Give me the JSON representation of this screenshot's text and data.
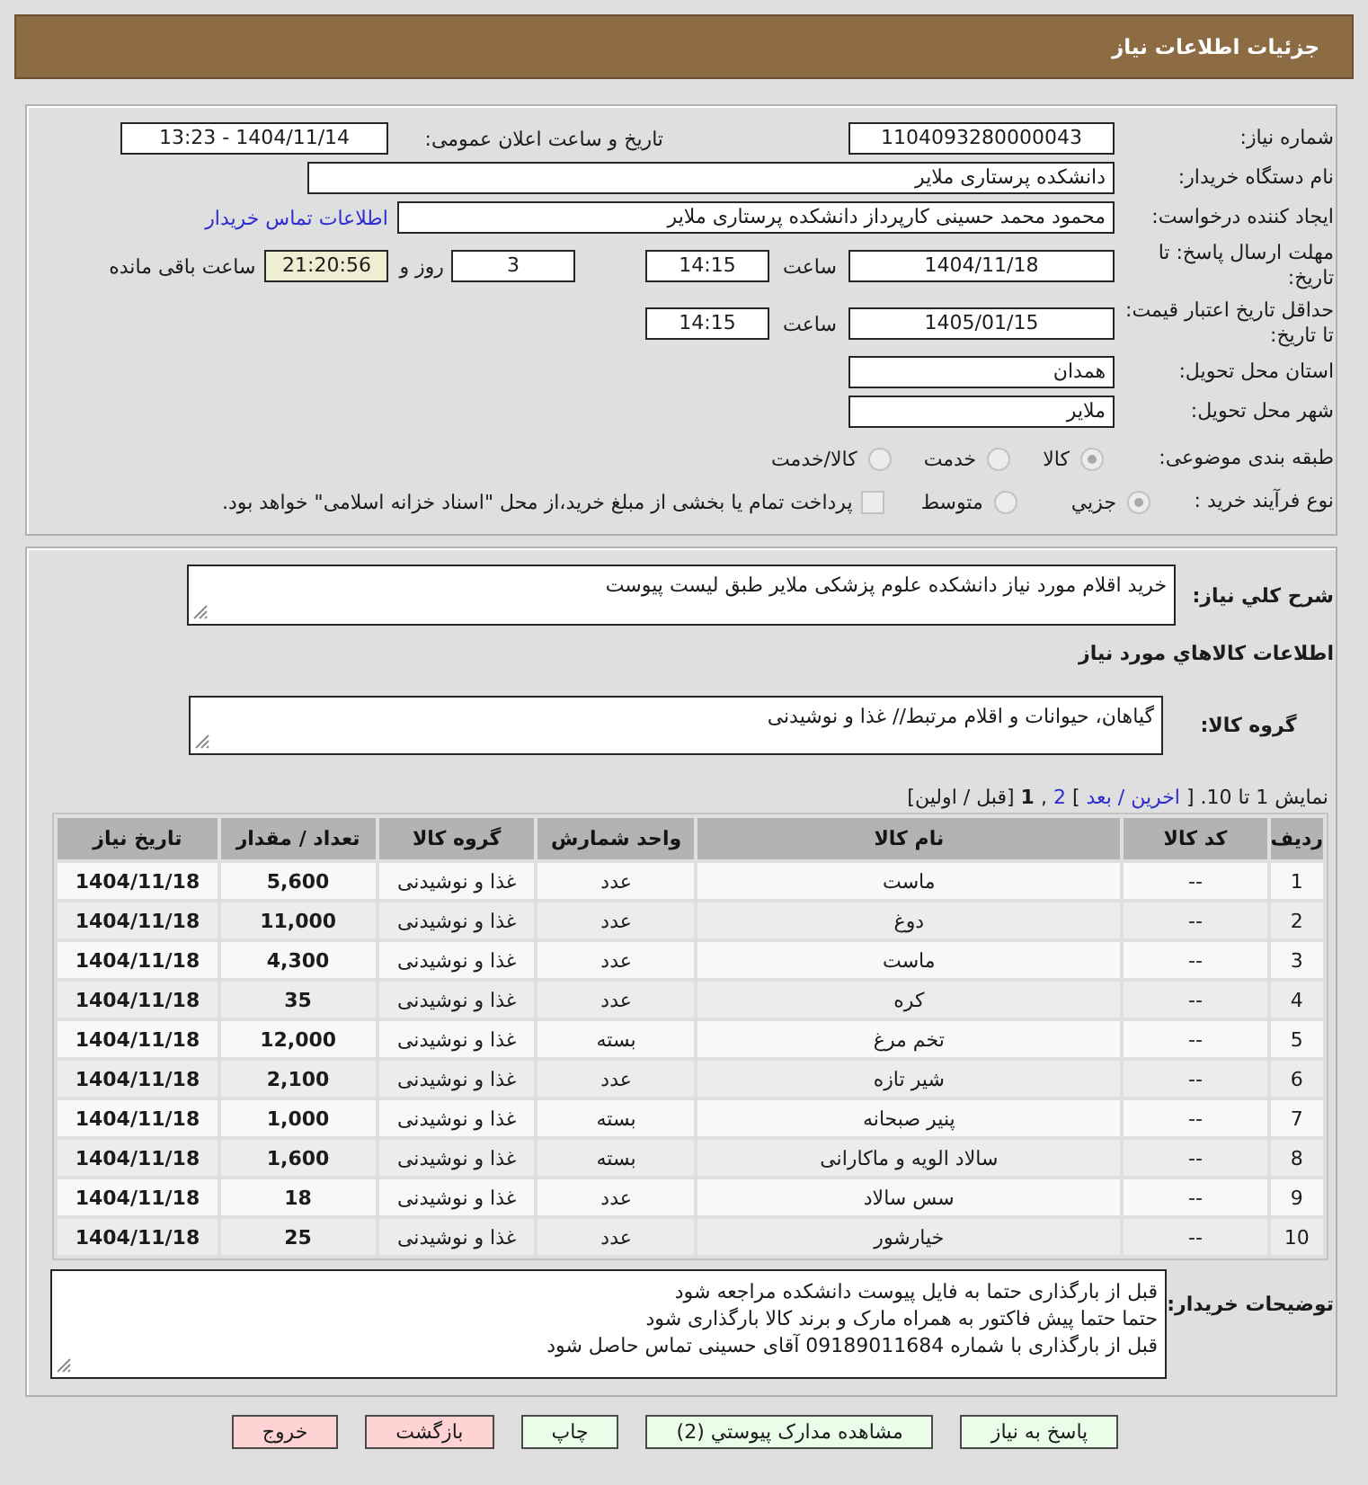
{
  "header": {
    "title": "جزئیات اطلاعات نیاز"
  },
  "details": {
    "need_number": {
      "label": "شماره نیاز:",
      "value": "1104093280000043"
    },
    "announcement": {
      "label": "تاریخ و ساعت اعلان عمومی:",
      "value": "1404/11/14 - 13:23"
    },
    "buyer_org": {
      "label": "نام دستگاه خریدار:",
      "value": "دانشکده پرستاری ملایر"
    },
    "requester": {
      "label": "ایجاد کننده درخواست:",
      "value": "محمود محمد حسینی کارپرداز دانشکده پرستاری ملایر",
      "contact_link": "اطلاعات تماس خریدار"
    },
    "reply_deadline": {
      "label": "مهلت ارسال پاسخ: تا تاریخ:",
      "date": "1404/11/18",
      "time_label": "ساعت",
      "time": "14:15",
      "days": "3",
      "days_label": "روز و",
      "remaining": "21:20:56",
      "remaining_label": "ساعت باقی مانده"
    },
    "price_validity": {
      "label": "حداقل تاریخ اعتبار قیمت: تا تاریخ:",
      "date": "1405/01/15",
      "time_label": "ساعت",
      "time": "14:15"
    },
    "province": {
      "label": "استان محل تحویل:",
      "value": "همدان"
    },
    "city": {
      "label": "شهر محل تحویل:",
      "value": "ملایر"
    },
    "category": {
      "label": "طبقه بندی موضوعی:",
      "disabled": true,
      "options": [
        {
          "label": "کالا",
          "selected": true
        },
        {
          "label": "خدمت",
          "selected": false
        },
        {
          "label": "کالا/خدمت",
          "selected": false
        }
      ]
    },
    "purchase_type": {
      "label": "نوع فرآیند خرید :",
      "disabled": true,
      "options": [
        {
          "label": "جزيي",
          "selected": true
        },
        {
          "label": "متوسط",
          "selected": false
        }
      ],
      "treasury_payment": {
        "label": "پرداخت تمام یا بخشی از مبلغ خرید،از محل \"اسناد خزانه اسلامی\" خواهد بود.",
        "checked": false
      }
    }
  },
  "description": {
    "label": "شرح کلي نياز:",
    "value": "خرید اقلام مورد نیاز دانشکده علوم پزشکی ملایر طبق لیست پیوست"
  },
  "goods": {
    "title": "اطلاعات کالاهاي مورد نياز",
    "group_label": "گروه کالا:",
    "group_value": "گیاهان، حیوانات و اقلام مرتبط// غذا و نوشیدنی",
    "pagination": [
      {
        "text": "نمایش 1 تا 10. [",
        "kind": "text"
      },
      {
        "text": "اخرین / بعد",
        "kind": "link"
      },
      {
        "text": "]",
        "kind": "text"
      },
      {
        "text": "2",
        "kind": "link"
      },
      {
        "text": ",",
        "kind": "text"
      },
      {
        "text": "1",
        "kind": "current"
      },
      {
        "text": "[قبل / اولین]",
        "kind": "text"
      }
    ],
    "table": {
      "columns": [
        "ردیف",
        "کد کالا",
        "نام کالا",
        "واحد شمارش",
        "گروه کالا",
        "تعداد / مقدار",
        "تاریخ نیاز"
      ],
      "rows": [
        [
          "1",
          "--",
          "ماست",
          "عدد",
          "غذا و نوشیدنی",
          "5,600",
          "1404/11/18"
        ],
        [
          "2",
          "--",
          "دوغ",
          "عدد",
          "غذا و نوشیدنی",
          "11,000",
          "1404/11/18"
        ],
        [
          "3",
          "--",
          "ماست",
          "عدد",
          "غذا و نوشیدنی",
          "4,300",
          "1404/11/18"
        ],
        [
          "4",
          "--",
          "کره",
          "عدد",
          "غذا و نوشیدنی",
          "35",
          "1404/11/18"
        ],
        [
          "5",
          "--",
          "تخم مرغ",
          "بسته",
          "غذا و نوشیدنی",
          "12,000",
          "1404/11/18"
        ],
        [
          "6",
          "--",
          "شیر تازه",
          "عدد",
          "غذا و نوشیدنی",
          "2,100",
          "1404/11/18"
        ],
        [
          "7",
          "--",
          "پنیر صبحانه",
          "بسته",
          "غذا و نوشیدنی",
          "1,000",
          "1404/11/18"
        ],
        [
          "8",
          "--",
          "سالاد الویه و ماکارانی",
          "بسته",
          "غذا و نوشیدنی",
          "1,600",
          "1404/11/18"
        ],
        [
          "9",
          "--",
          "سس سالاد",
          "عدد",
          "غذا و نوشیدنی",
          "18",
          "1404/11/18"
        ],
        [
          "10",
          "--",
          "خیارشور",
          "عدد",
          "غذا و نوشیدنی",
          "25",
          "1404/11/18"
        ]
      ]
    }
  },
  "buyer_notes": {
    "label": "توضیحات خریدار:",
    "lines": [
      "قبل از بارگذاری حتما به فایل پیوست دانشکده مراجعه شود",
      "حتما حتما پیش فاکتور به همراه مارک و برند کالا بارگذاری شود",
      "قبل از بارگذاری با شماره 09189011684 آقای حسینی تماس حاصل شود"
    ]
  },
  "buttons": [
    {
      "label": "پاسخ به نیاز",
      "kind": "normal"
    },
    {
      "label": "مشاهده مدارک پیوستي (2)",
      "kind": "normal"
    },
    {
      "label": "چاپ",
      "kind": "normal"
    },
    {
      "label": "بازگشت",
      "kind": "alert"
    },
    {
      "label": "خروج",
      "kind": "alert"
    }
  ]
}
